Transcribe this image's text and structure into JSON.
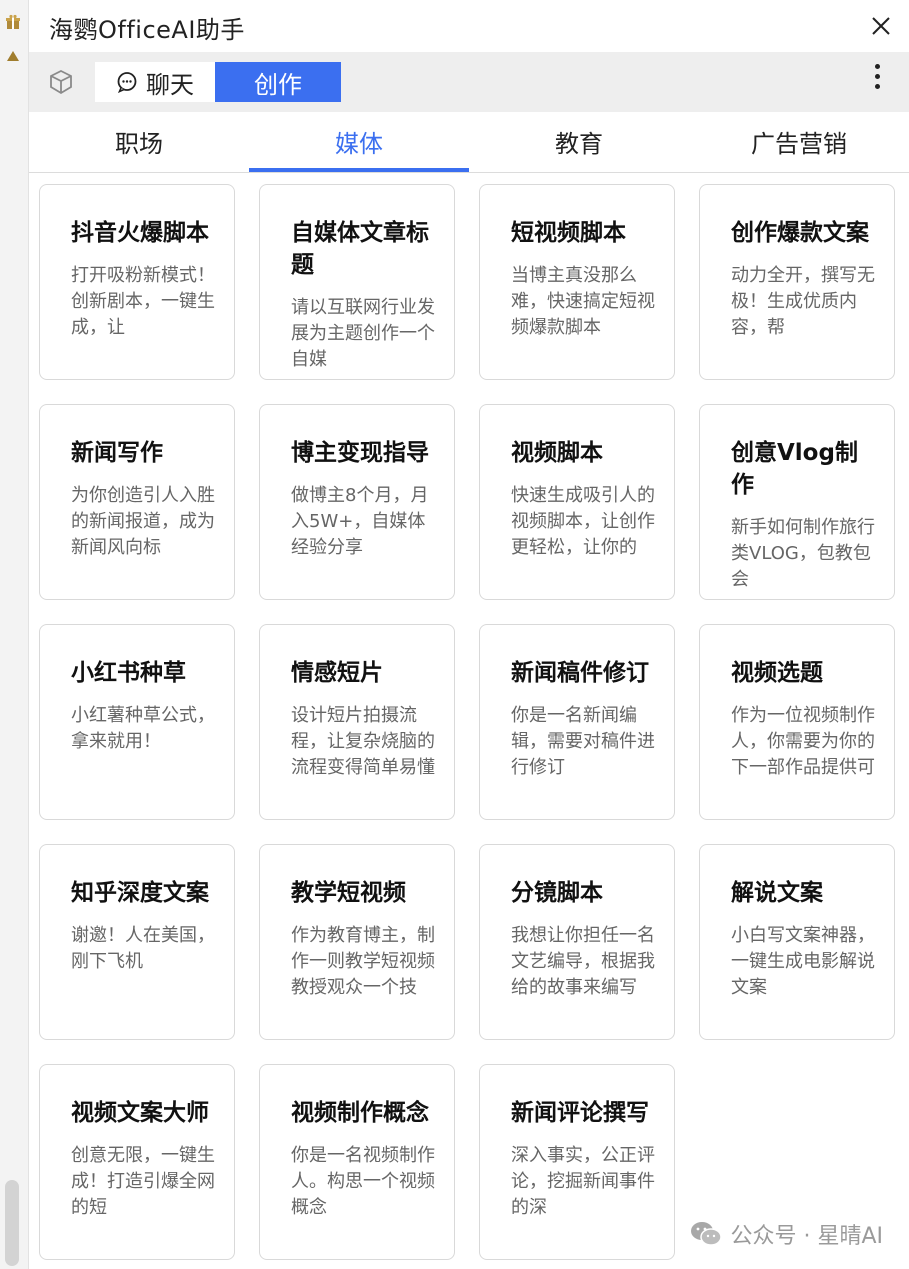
{
  "app": {
    "title": "海鹦OfficeAI助手"
  },
  "toolbar": {
    "chat_label": "聊天",
    "create_label": "创作"
  },
  "categories": [
    {
      "label": "职场",
      "active": false
    },
    {
      "label": "媒体",
      "active": true
    },
    {
      "label": "教育",
      "active": false
    },
    {
      "label": "广告营销",
      "active": false
    }
  ],
  "cards": [
    {
      "title": "抖音火爆脚本",
      "desc": "打开吸粉新模式！创新剧本，一键生成，让"
    },
    {
      "title": "自媒体文章标题",
      "desc": "请以互联网行业发展为主题创作一个自媒"
    },
    {
      "title": "短视频脚本",
      "desc": "当博主真没那么难，快速搞定短视频爆款脚本"
    },
    {
      "title": "创作爆款文案",
      "desc": "动力全开，撰写无极！生成优质内容，帮"
    },
    {
      "title": "新闻写作",
      "desc": "为你创造引人入胜的新闻报道，成为新闻风向标"
    },
    {
      "title": "博主变现指导",
      "desc": "做博主8个月，月入5W+，自媒体经验分享"
    },
    {
      "title": "视频脚本",
      "desc": "快速生成吸引人的视频脚本，让创作更轻松，让你的"
    },
    {
      "title": "创意Vlog制作",
      "desc": "新手如何制作旅行类VLOG，包教包会"
    },
    {
      "title": "小红书种草",
      "desc": "小红薯种草公式，拿来就用！"
    },
    {
      "title": "情感短片",
      "desc": "设计短片拍摄流程，让复杂烧脑的流程变得简单易懂"
    },
    {
      "title": "新闻稿件修订",
      "desc": "你是一名新闻编辑，需要对稿件进行修订"
    },
    {
      "title": "视频选题",
      "desc": "作为一位视频制作人，你需要为你的下一部作品提供可"
    },
    {
      "title": "知乎深度文案",
      "desc": "谢邀！人在美国，刚下飞机"
    },
    {
      "title": "教学短视频",
      "desc": "作为教育博主，制作一则教学短视频教授观众一个技"
    },
    {
      "title": "分镜脚本",
      "desc": "我想让你担任一名文艺编导，根据我给的故事来编写"
    },
    {
      "title": "解说文案",
      "desc": "小白写文案神器，一键生成电影解说文案"
    },
    {
      "title": "视频文案大师",
      "desc": "创意无限，一键生成！打造引爆全网的短"
    },
    {
      "title": "视频制作概念",
      "desc": "你是一名视频制作人。构思一个视频概念"
    },
    {
      "title": "新闻评论撰写",
      "desc": "深入事实，公正评论，挖掘新闻事件的深"
    }
  ],
  "watermark": {
    "text": "公众号 · 星晴AI"
  },
  "colors": {
    "accent": "#3b6ff0"
  }
}
